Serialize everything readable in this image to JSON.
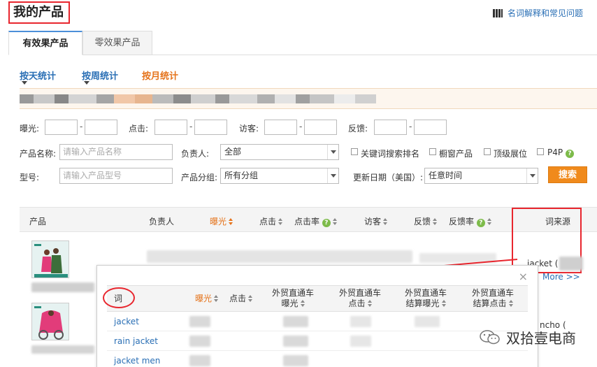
{
  "header": {
    "title": "我的产品",
    "help_link": "名词解释和常见问题"
  },
  "tabs": [
    {
      "label": "有效果产品"
    },
    {
      "label": "零效果产品"
    }
  ],
  "stats": [
    {
      "label": "按天统计"
    },
    {
      "label": "按周统计"
    },
    {
      "label": "按月统计"
    }
  ],
  "filters": {
    "exposure_label": "曝光:",
    "click_label": "点击:",
    "visitor_label": "访客:",
    "feedback_label": "反馈:",
    "name_label": "产品名称:",
    "name_placeholder": "请输入产品名称",
    "owner_label": "负责人:",
    "owner_value": "全部",
    "model_label": "型号:",
    "model_placeholder": "请输入产品型号",
    "group_label": "产品分组:",
    "group_value": "所有分组",
    "keyword_rank": "关键词搜索排名",
    "showcase": "橱窗产品",
    "top_rank": "顶级展位",
    "p4p": "P4P",
    "update_label": "更新日期（美国）:",
    "update_value": "任意时间",
    "search_button": "搜索"
  },
  "table": {
    "headers": [
      "产品",
      "负责人",
      "曝光",
      "点击",
      "点击率",
      "访客",
      "反馈",
      "反馈率",
      "词来源"
    ],
    "rows": [
      {
        "keyword_source": "jacket ("
      },
      {
        "keyword_source": "ncho ("
      }
    ],
    "more_link": "More >>"
  },
  "popup": {
    "headers": [
      "词",
      "曝光",
      "点击",
      "外贸直通车 曝光",
      "外贸直通车 点击",
      "外贸直通车 结算曝光",
      "外贸直通车 结算点击"
    ],
    "rows": [
      "jacket",
      "rain jacket",
      "jacket men"
    ],
    "close": "×"
  },
  "watermark": "双拾壹电商",
  "colors": {
    "accent_orange": "#e5731b",
    "link_blue": "#2a6fb5",
    "annotation_red": "#e8262e"
  }
}
